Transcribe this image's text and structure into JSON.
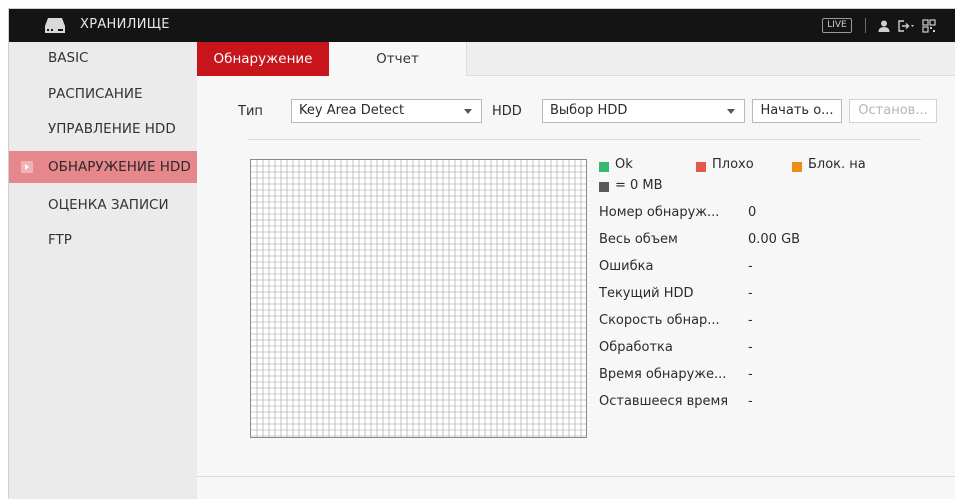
{
  "titlebar": {
    "title": "ХРАНИЛИЩЕ",
    "live_label": "LIVE",
    "icons": [
      "hdd-icon",
      "user-icon",
      "logout-icon",
      "qr-icon"
    ]
  },
  "sidebar": {
    "items": [
      {
        "label": "BASIC",
        "active": false
      },
      {
        "label": "РАСПИСАНИЕ",
        "active": false
      },
      {
        "label": "УПРАВЛЕНИЕ HDD",
        "active": false
      },
      {
        "label": "ОБНАРУЖЕНИЕ HDD",
        "active": true
      },
      {
        "label": "ОЦЕНКА ЗАПИСИ",
        "active": false
      },
      {
        "label": "FTP",
        "active": false
      }
    ]
  },
  "tabs": [
    {
      "label": "Обнаружение",
      "active": true
    },
    {
      "label": "Отчет",
      "active": false
    }
  ],
  "controls": {
    "type_label": "Тип",
    "type_value": "Key Area Detect",
    "hdd_label": "HDD",
    "hdd_value": "Выбор HDD",
    "start_button": "Начать о...",
    "stop_button": "Останов..."
  },
  "legend": {
    "ok": {
      "label": "Ok",
      "color": "#3cb86e"
    },
    "bad": {
      "label": "Плохо",
      "color": "#e8584a"
    },
    "blocked": {
      "label": "Блок. на",
      "color": "#ef8c12"
    },
    "zero": {
      "label": "= 0 MB",
      "color": "#595a5e"
    }
  },
  "info": [
    {
      "label": "Номер обнаруж...",
      "value": "0"
    },
    {
      "label": "Весь объем",
      "value": "0.00 GB"
    },
    {
      "label": "Ошибка",
      "value": "-"
    },
    {
      "label": "Текущий HDD",
      "value": "-"
    },
    {
      "label": "Скорость обнар...",
      "value": "-"
    },
    {
      "label": "Обработка",
      "value": "-"
    },
    {
      "label": "Время обнаруже...",
      "value": "-"
    },
    {
      "label": "Оставшееся время",
      "value": "-"
    }
  ]
}
